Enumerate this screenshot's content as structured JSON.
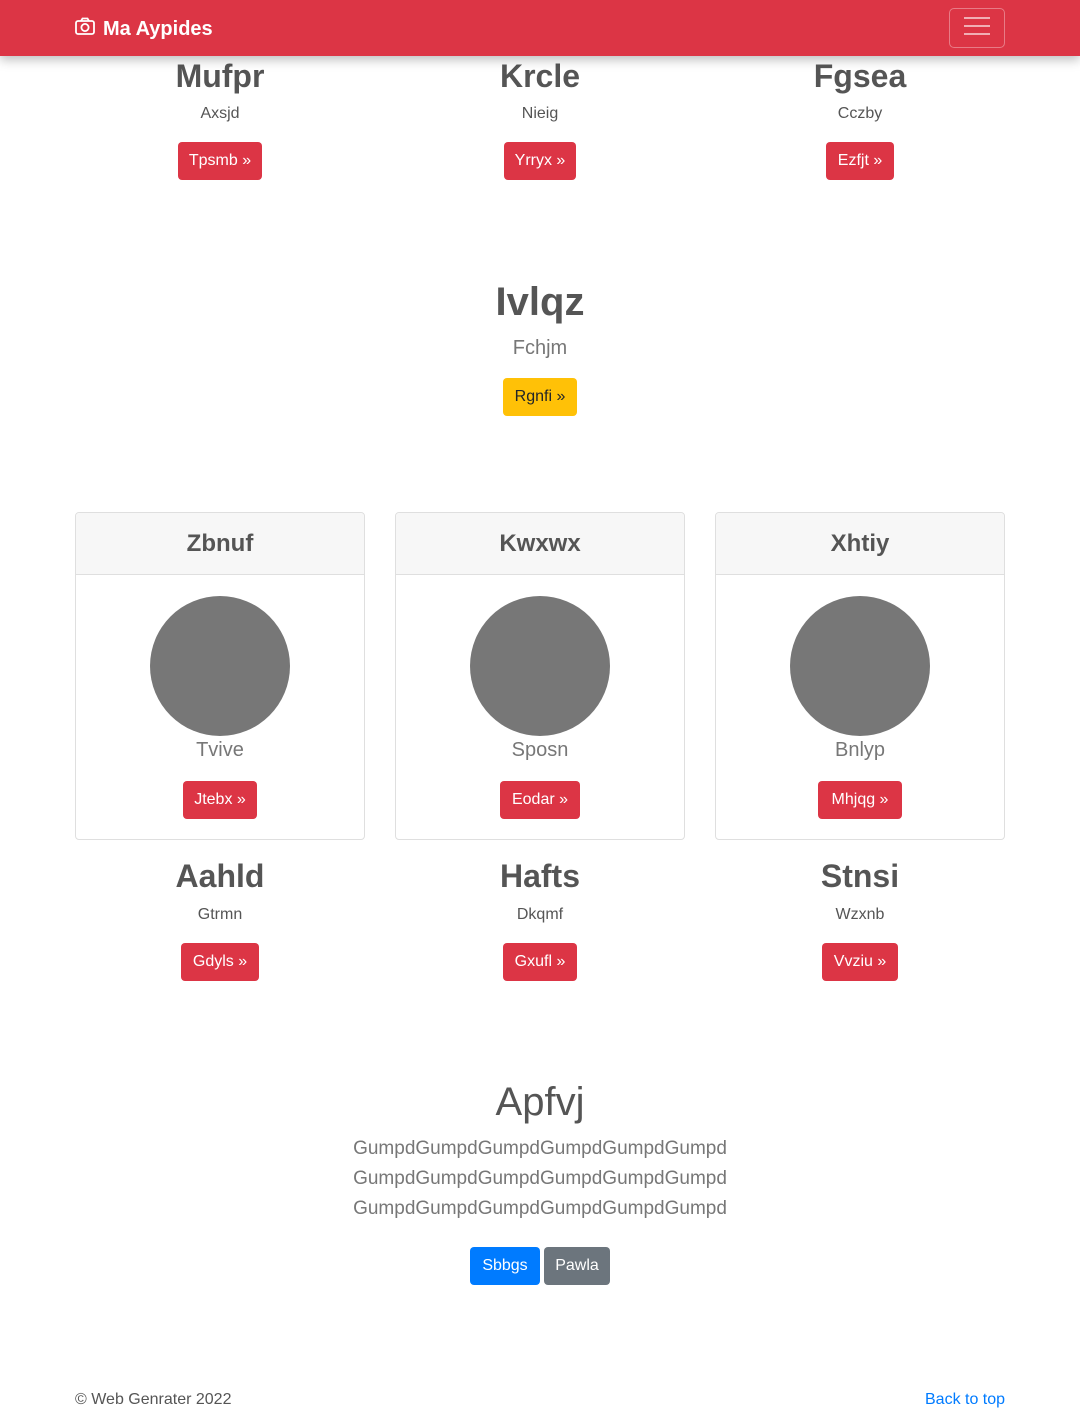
{
  "navbar": {
    "brand": "Ma Aypides",
    "brand_icon": "camera-icon",
    "toggler_icon": "hamburger-menu-icon",
    "color": "#dc3545"
  },
  "top_row": [
    {
      "title": "Mufpr",
      "subtitle": "Axsjd",
      "button": "Tpsmb »"
    },
    {
      "title": "Krcle",
      "subtitle": "Nieig",
      "button": "Yrryx »"
    },
    {
      "title": "Fgsea",
      "subtitle": "Cczby",
      "button": "Ezfjt »"
    }
  ],
  "hero": {
    "title": "Ivlqz",
    "subtitle": "Fchjm",
    "button": "Rgnfi »",
    "button_color": "#ffc107"
  },
  "cards": [
    {
      "header": "Zbnuf",
      "subtitle": "Tvive",
      "button": "Jtebx »"
    },
    {
      "header": "Kwxwx",
      "subtitle": "Sposn",
      "button": "Eodar »"
    },
    {
      "header": "Xhtiy",
      "subtitle": "Bnlyp",
      "button": "Mhjqg »"
    }
  ],
  "bottom_row": [
    {
      "title": "Aahld",
      "subtitle": "Gtrmn",
      "button": "Gdyls »"
    },
    {
      "title": "Hafts",
      "subtitle": "Dkqmf",
      "button": "Gxufl »"
    },
    {
      "title": "Stnsi",
      "subtitle": "Wzxnb",
      "button": "Vvziu »"
    }
  ],
  "jumbotron": {
    "title": "Apfvj",
    "lines": [
      "GumpdGumpdGumpdGumpdGumpdGumpd",
      "GumpdGumpdGumpdGumpdGumpdGumpd",
      "GumpdGumpdGumpdGumpdGumpdGumpd"
    ],
    "primary_button": "Sbbgs",
    "secondary_button": "Pawla"
  },
  "footer": {
    "copyright": "© Web Genrater 2022",
    "back_to_top": "Back to top"
  }
}
